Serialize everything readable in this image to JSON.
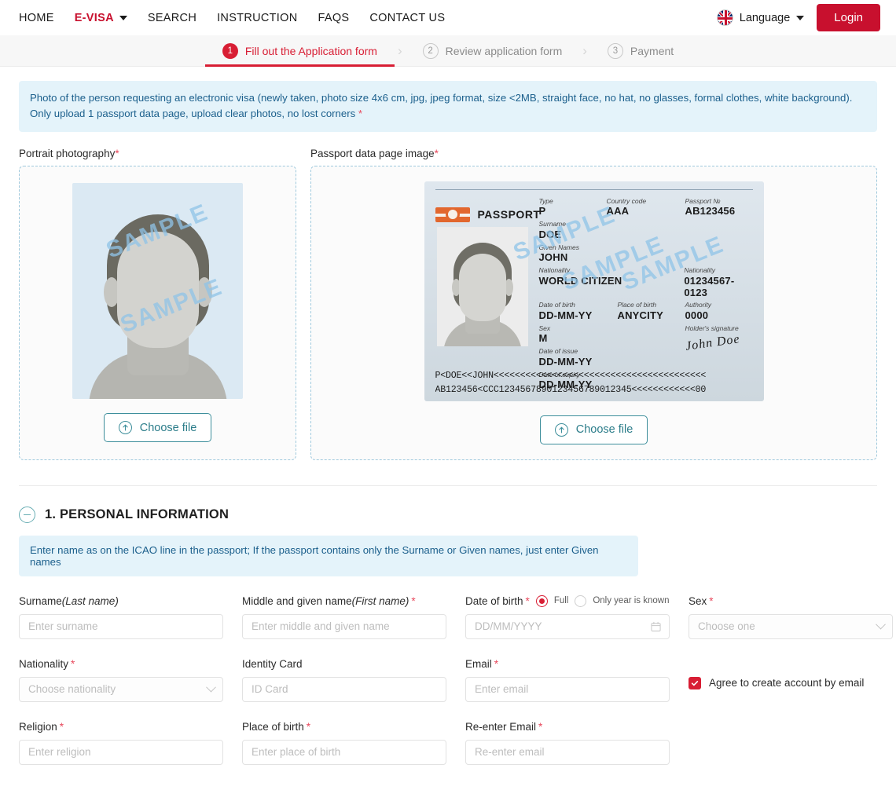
{
  "nav": {
    "items": [
      {
        "label": "HOME",
        "active": false,
        "dropdown": false
      },
      {
        "label": "E-VISA",
        "active": true,
        "dropdown": true
      },
      {
        "label": "SEARCH",
        "active": false,
        "dropdown": false
      },
      {
        "label": "INSTRUCTION",
        "active": false,
        "dropdown": false
      },
      {
        "label": "FAQS",
        "active": false,
        "dropdown": false
      },
      {
        "label": "CONTACT US",
        "active": false,
        "dropdown": false
      }
    ],
    "language_label": "Language",
    "language_icon": "uk-flag-icon",
    "login_label": "Login",
    "brand_color": "#c8102e"
  },
  "stepper": {
    "steps": [
      {
        "num": "1",
        "label": "Fill out the Application form",
        "state": "active"
      },
      {
        "num": "2",
        "label": "Review application form",
        "state": "idle"
      },
      {
        "num": "3",
        "label": "Payment",
        "state": "idle"
      }
    ],
    "separator": "›",
    "active_color": "#d81e34"
  },
  "notice": {
    "line1": "Photo of the person requesting an electronic visa (newly taken, photo size 4x6 cm, jpg, jpeg format, size <2MB, straight face, no hat, no glasses, formal clothes, white background).",
    "line2": "Only upload 1 passport data page, upload clear photos, no lost corners",
    "required_mark": "*",
    "bg": "#e4f3fa",
    "fg": "#1b5f8c"
  },
  "uploads": {
    "portrait": {
      "label": "Portrait photography",
      "required_mark": "*",
      "button_label": "Choose file",
      "button_icon": "upload-circle-icon",
      "watermark": "SAMPLE"
    },
    "passport": {
      "label": "Passport data page image",
      "required_mark": "*",
      "button_label": "Choose file",
      "button_icon": "upload-circle-icon",
      "watermark": "SAMPLE",
      "sample": {
        "doc_title": "PASSPORT",
        "fields": [
          {
            "label": "Type",
            "value": "P"
          },
          {
            "label": "Country code",
            "value": "AAA"
          },
          {
            "label": "Passport №",
            "value": "AB123456"
          },
          {
            "label": "Surname",
            "value": "DOE"
          },
          {
            "label": "Given Names",
            "value": "JOHN"
          },
          {
            "label": "Nationality",
            "value": "WORLD CITIZEN"
          },
          {
            "label": "Nationality",
            "value": "01234567-0123"
          },
          {
            "label": "Date of birth",
            "value": "DD-MM-YY"
          },
          {
            "label": "Place of birth",
            "value": "ANYCITY"
          },
          {
            "label": "Authority",
            "value": "0000"
          },
          {
            "label": "Sex",
            "value": "M"
          },
          {
            "label": "Date of issue",
            "value": "DD-MM-YY"
          },
          {
            "label": "Date of expiry",
            "value": "DD-MM-YY"
          },
          {
            "label": "Holder's signature",
            "value": "John Doe"
          }
        ],
        "mrz_line1": "P<DOE<<JOHN<<<<<<<<<<<<<<<<<<<<<<<<<<<<<<<<<<<<<<<<",
        "mrz_line2": "AB123456<CCC1234567890123456789012345<<<<<<<<<<<<00"
      }
    }
  },
  "section": {
    "toggle_icon": "minus-circle-icon",
    "title": "1. PERSONAL INFORMATION",
    "icao_note": "Enter name as on the ICAO line in the passport; If the passport contains only the Surname or Given names, just enter Given names"
  },
  "form": {
    "surname": {
      "label": "Surname ",
      "label_italic": "(Last name)",
      "placeholder": "Enter surname",
      "value": "",
      "required": false
    },
    "given_name": {
      "label": "Middle and given name ",
      "label_italic": "(First name)",
      "placeholder": "Enter middle and given name",
      "value": "",
      "required": true,
      "required_mark": "*"
    },
    "dob": {
      "label": "Date of birth",
      "required_mark": "*",
      "placeholder": "DD/MM/YYYY",
      "value": "",
      "icon": "calendar-icon",
      "options": [
        {
          "label": "Full",
          "selected": true
        },
        {
          "label": "Only year is known",
          "selected": false
        }
      ]
    },
    "sex": {
      "label": "Sex",
      "required_mark": "*",
      "placeholder": "Choose one",
      "value": "",
      "icon": "chevron-down-icon"
    },
    "nationality": {
      "label": "Nationality",
      "required_mark": "*",
      "placeholder": "Choose nationality",
      "value": "",
      "icon": "chevron-down-icon"
    },
    "identity_card": {
      "label": "Identity Card",
      "placeholder": "ID Card",
      "value": ""
    },
    "email": {
      "label": "Email",
      "required_mark": "*",
      "placeholder": "Enter email",
      "value": ""
    },
    "agree": {
      "label": "Agree to create account by email",
      "checked": true,
      "color": "#d81e34"
    },
    "religion": {
      "label": "Religion",
      "required_mark": "*",
      "placeholder": "Enter religion",
      "value": ""
    },
    "place_of_birth": {
      "label": "Place of birth",
      "required_mark": "*",
      "placeholder": "Enter place of birth",
      "value": ""
    },
    "reenter_email": {
      "label": "Re-enter Email",
      "required_mark": "*",
      "placeholder": "Re-enter email",
      "value": ""
    }
  }
}
